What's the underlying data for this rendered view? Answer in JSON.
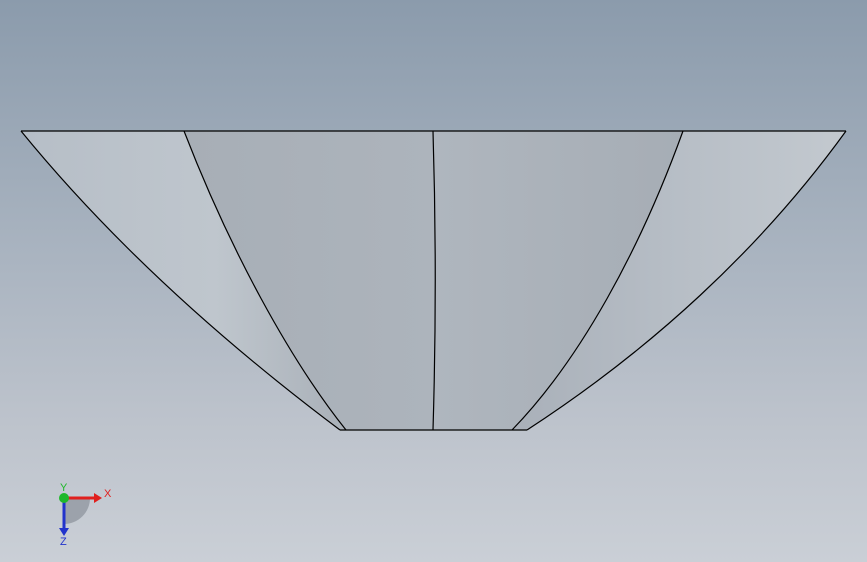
{
  "viewport": {
    "background_top": "#8b9bac",
    "background_bottom": "#cacfd6",
    "model": {
      "face_color": "#b3bac2",
      "edge_color": "#000000"
    }
  },
  "triad": {
    "x_label": "X",
    "y_label": "Y",
    "z_label": "Z",
    "x_color": "#e0201e",
    "y_color": "#1fb82a",
    "z_color": "#2233cc"
  }
}
